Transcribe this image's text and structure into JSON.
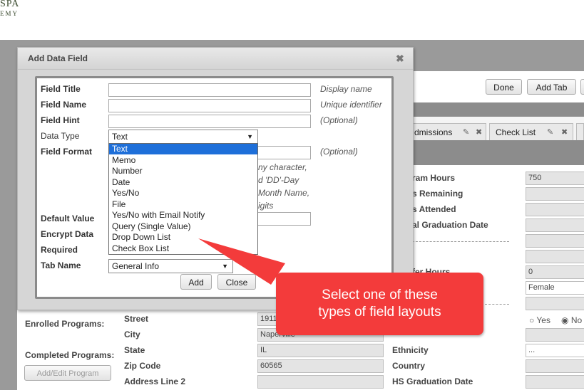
{
  "logo": {
    "line1": "SPA",
    "line2": "EMY"
  },
  "toolbar": {
    "done_label": "Done",
    "add_tab_label": "Add Tab"
  },
  "tabs": [
    {
      "label": "dmissions"
    },
    {
      "label": "Check List"
    }
  ],
  "right_form": {
    "labels": [
      "ram Hours",
      "s Remaining",
      "s Attended",
      "al Graduation Date",
      "fer Hours",
      "Ethnicity",
      "Country",
      "HS Graduation Date"
    ],
    "values": {
      "hours": "750",
      "transfer": "0",
      "gender": "Female",
      "ethnicity": "..."
    },
    "radio_yes": "Yes",
    "radio_no": "No"
  },
  "left_panel": {
    "enrolled": "Enrolled Programs:",
    "completed": "Completed Programs:",
    "add_edit": "Add/Edit Program"
  },
  "address": {
    "labels": [
      "Street",
      "City",
      "State",
      "Zip Code",
      "Address Line 2"
    ],
    "street": "1911",
    "city": "Naperville",
    "state": "IL",
    "zip": "60565"
  },
  "dialog": {
    "title": "Add Data Field",
    "close_icon": "close-icon",
    "fields": {
      "title_label": "Field Title",
      "name_label": "Field Name",
      "hint_label": "Field Hint",
      "type_label": "Data Type",
      "format_label": "Field Format",
      "default_label": "Default Value",
      "encrypt_label": "Encrypt Data",
      "required_label": "Required",
      "tabname_label": "Tab Name"
    },
    "hints": {
      "title": "Display name",
      "name": "Unique identifier",
      "hint": "(Optional)",
      "format": "(Optional)",
      "format_help": [
        "ny character,",
        "d 'DD'-Day",
        "Month Name,",
        "igits"
      ]
    },
    "data_type_selected": "Text",
    "tab_name_selected": "General Info",
    "data_type_options": [
      "Text",
      "Memo",
      "Number",
      "Date",
      "Yes/No",
      "File",
      "Yes/No with Email Notify",
      "Query (Single Value)",
      "Drop Down List",
      "Check Box List"
    ],
    "add_label": "Add",
    "close_label": "Close"
  },
  "callout": {
    "line1": "Select one of these",
    "line2": "types of field layouts"
  },
  "colors": {
    "callout": "#f33b3b",
    "highlight": "#1e6fd9"
  }
}
